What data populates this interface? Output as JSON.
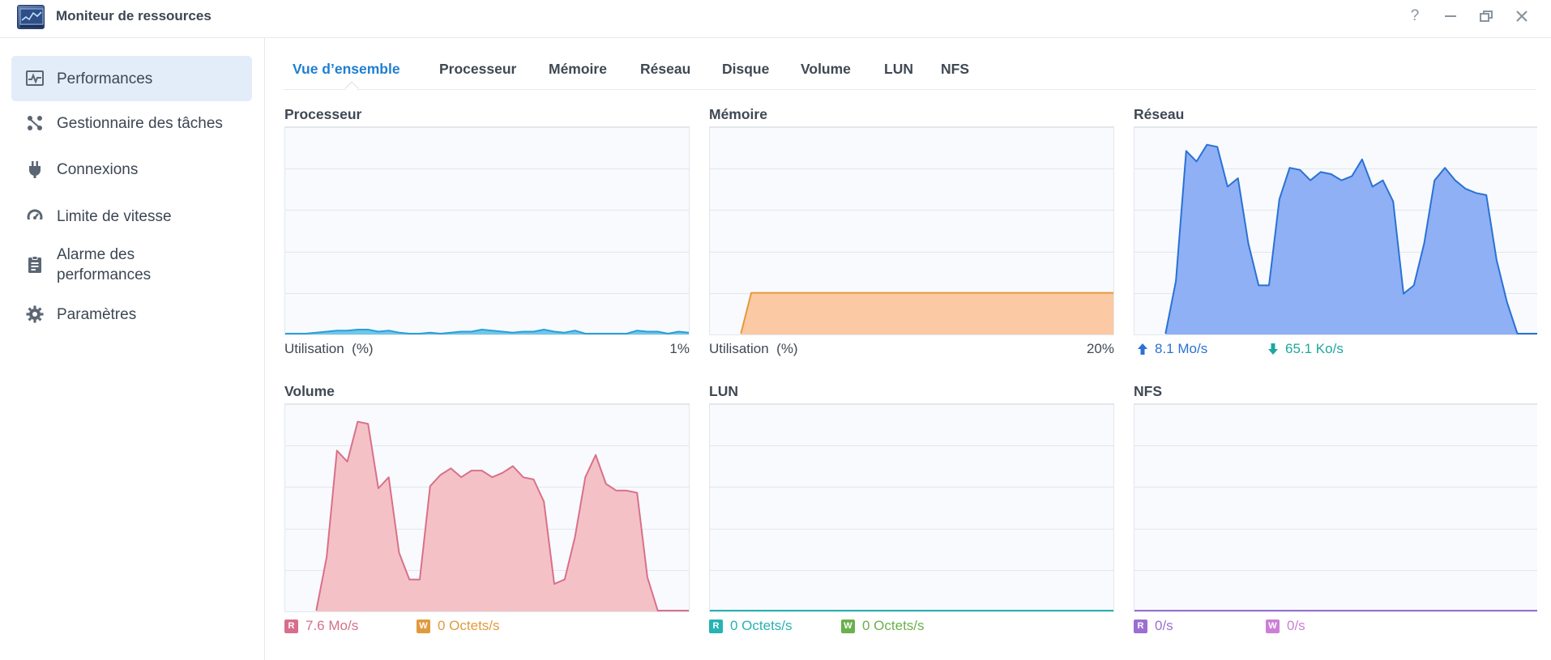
{
  "window": {
    "title": "Moniteur de ressources",
    "controls": {
      "help": "?",
      "minimize": "—",
      "close": "✕"
    }
  },
  "sidebar": {
    "items": [
      {
        "label": "Performances",
        "icon": "performance-chart-icon",
        "active": true
      },
      {
        "label": "Gestionnaire des tâches",
        "icon": "task-manager-icon",
        "active": false
      },
      {
        "label": "Connexions",
        "icon": "plug-icon",
        "active": false
      },
      {
        "label": "Limite de vitesse",
        "icon": "speedometer-icon",
        "active": false
      },
      {
        "label": "Alarme des performances",
        "icon": "clipboard-alarm-icon",
        "active": false
      },
      {
        "label": "Paramètres",
        "icon": "gear-icon",
        "active": false
      }
    ]
  },
  "tabs": {
    "items": [
      "Vue d’ensemble",
      "Processeur",
      "Mémoire",
      "Réseau",
      "Disque",
      "Volume",
      "LUN",
      "NFS"
    ],
    "active_index": 0
  },
  "colors": {
    "accent": "#1f7fd1",
    "cpu_line": "#2a9fd8",
    "cpu_fill": "#6fc7ea",
    "mem_line": "#e39a3c",
    "mem_fill": "#fbc9a3",
    "net_line": "#2a72d4",
    "net_fill": "#8fb0f5",
    "vol_line": "#d9708a",
    "vol_fill": "#f4c2c6",
    "vol_read": "#d66f8c",
    "vol_write": "#e09a3e",
    "lun_read": "#26b3b3",
    "lun_write": "#6ab04c",
    "nfs_read": "#9b6fd1",
    "nfs_write": "#cc7fd6"
  },
  "panels": {
    "cpu": {
      "title": "Processeur",
      "footer_label": "Utilisation",
      "footer_unit": "(%)",
      "footer_value": "1%"
    },
    "memory": {
      "title": "Mémoire",
      "footer_label": "Utilisation",
      "footer_unit": "(%)",
      "footer_value": "20%"
    },
    "network": {
      "title": "Réseau",
      "upload": "8.1 Mo/s",
      "download": "65.1 Ko/s"
    },
    "volume": {
      "title": "Volume",
      "read_badge": "R",
      "read": "7.6 Mo/s",
      "write_badge": "W",
      "write": "0 Octets/s"
    },
    "lun": {
      "title": "LUN",
      "read_badge": "R",
      "read": "0 Octets/s",
      "write_badge": "W",
      "write": "0 Octets/s"
    },
    "nfs": {
      "title": "NFS",
      "read_badge": "R",
      "read": "0/s",
      "write_badge": "W",
      "write": "0/s"
    }
  },
  "chart_data": [
    {
      "type": "area",
      "name": "cpu",
      "ylim": [
        0,
        100
      ],
      "grid": true,
      "values": [
        0,
        0,
        0,
        0.5,
        1,
        1.5,
        1.5,
        2,
        2,
        1,
        1.5,
        0.5,
        0,
        0,
        0.5,
        0,
        0.5,
        1,
        1,
        2,
        1.5,
        1,
        0.5,
        1,
        1,
        2,
        1,
        0.5,
        1.5,
        0,
        0,
        0,
        0,
        0,
        1.5,
        1,
        1,
        0,
        1,
        0.5
      ]
    },
    {
      "type": "area",
      "name": "memory",
      "ylim": [
        0,
        100
      ],
      "grid": true,
      "values": [
        null,
        null,
        null,
        0,
        20,
        20,
        20,
        20,
        20,
        20,
        20,
        20,
        20,
        20,
        20,
        20,
        20,
        20,
        20,
        20,
        20,
        20,
        20,
        20,
        20,
        20,
        20,
        20,
        20,
        20,
        20,
        20,
        20,
        20,
        20,
        20,
        20,
        20,
        20,
        20
      ]
    },
    {
      "type": "area",
      "name": "network",
      "grid": true,
      "values": [
        null,
        null,
        null,
        0,
        2.5,
        8.7,
        8.2,
        9,
        8.9,
        7,
        7.4,
        4.3,
        2.3,
        2.3,
        6.4,
        7.9,
        7.8,
        7.3,
        7.7,
        7.6,
        7.3,
        7.5,
        8.3,
        7,
        7.3,
        6.3,
        1.9,
        2.3,
        4.3,
        7.3,
        7.9,
        7.3,
        6.9,
        6.7,
        6.6,
        3.5,
        1.5,
        0,
        0,
        0
      ]
    },
    {
      "type": "area",
      "name": "volume",
      "grid": true,
      "values": [
        null,
        null,
        null,
        0,
        2.4,
        7.2,
        6.7,
        8.5,
        8.4,
        5.5,
        6,
        2.6,
        1.4,
        1.4,
        5.6,
        6.1,
        6.4,
        6,
        6.3,
        6.3,
        6,
        6.2,
        6.5,
        6,
        5.9,
        4.9,
        1.2,
        1.4,
        3.3,
        6,
        7,
        5.7,
        5.4,
        5.4,
        5.3,
        1.5,
        0,
        0,
        0,
        0
      ]
    },
    {
      "type": "line",
      "name": "lun",
      "grid": true,
      "values": [
        0,
        0,
        0,
        0,
        0,
        0,
        0,
        0,
        0,
        0,
        0,
        0,
        0,
        0,
        0,
        0,
        0,
        0,
        0,
        0,
        0,
        0,
        0,
        0,
        0,
        0,
        0,
        0,
        0,
        0,
        0,
        0,
        0,
        0,
        0,
        0,
        0,
        0,
        0,
        0
      ]
    },
    {
      "type": "line",
      "name": "nfs",
      "grid": true,
      "values": [
        0,
        0,
        0,
        0,
        0,
        0,
        0,
        0,
        0,
        0,
        0,
        0,
        0,
        0,
        0,
        0,
        0,
        0,
        0,
        0,
        0,
        0,
        0,
        0,
        0,
        0,
        0,
        0,
        0,
        0,
        0,
        0,
        0,
        0,
        0,
        0,
        0,
        0,
        0,
        0
      ]
    }
  ]
}
